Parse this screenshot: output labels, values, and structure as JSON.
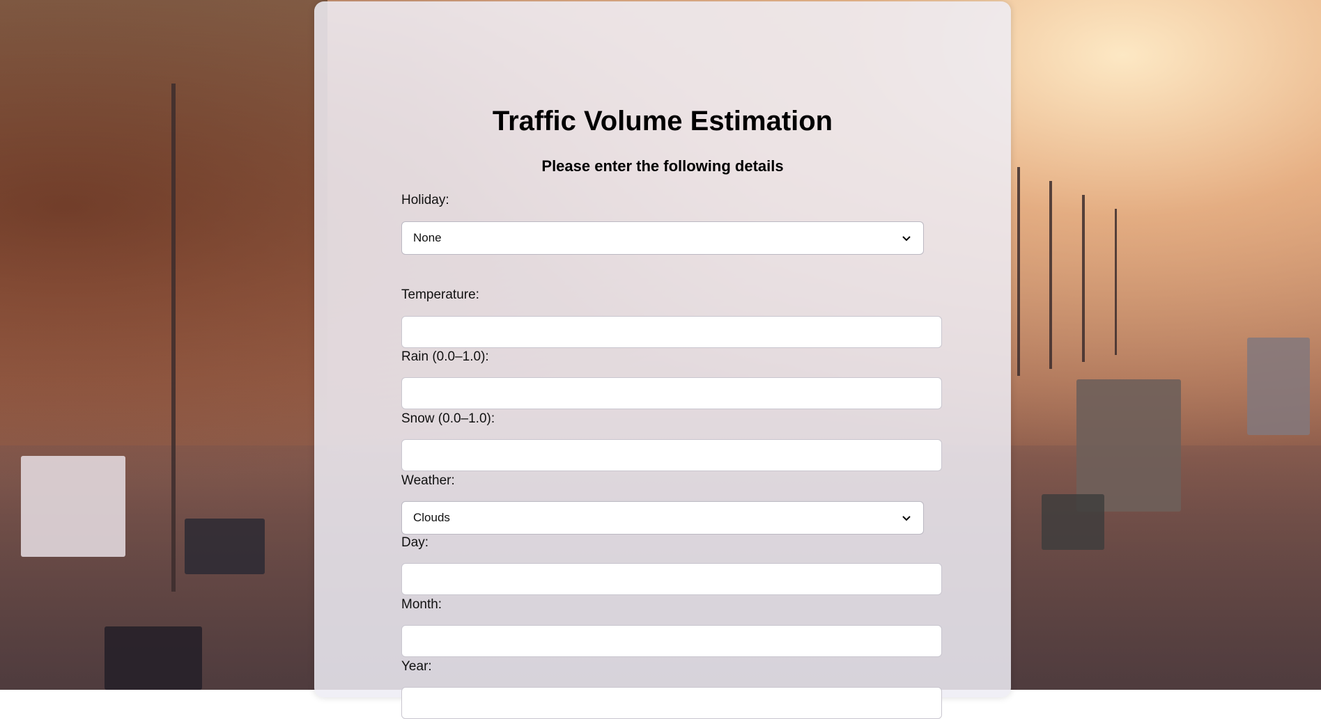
{
  "form": {
    "title": "Traffic Volume Estimation",
    "subtitle": "Please enter the following details",
    "holiday": {
      "label": "Holiday:",
      "value": "None"
    },
    "temperature": {
      "label": "Temperature:",
      "value": ""
    },
    "rain": {
      "label": "Rain (0.0–1.0):",
      "value": ""
    },
    "snow": {
      "label": "Snow (0.0–1.0):",
      "value": ""
    },
    "weather": {
      "label": "Weather:",
      "value": "Clouds"
    },
    "day": {
      "label": "Day:",
      "value": ""
    },
    "month": {
      "label": "Month:",
      "value": ""
    },
    "year": {
      "label": "Year:",
      "value": ""
    }
  },
  "icons": {
    "select_arrow": "chevron-down-icon"
  }
}
